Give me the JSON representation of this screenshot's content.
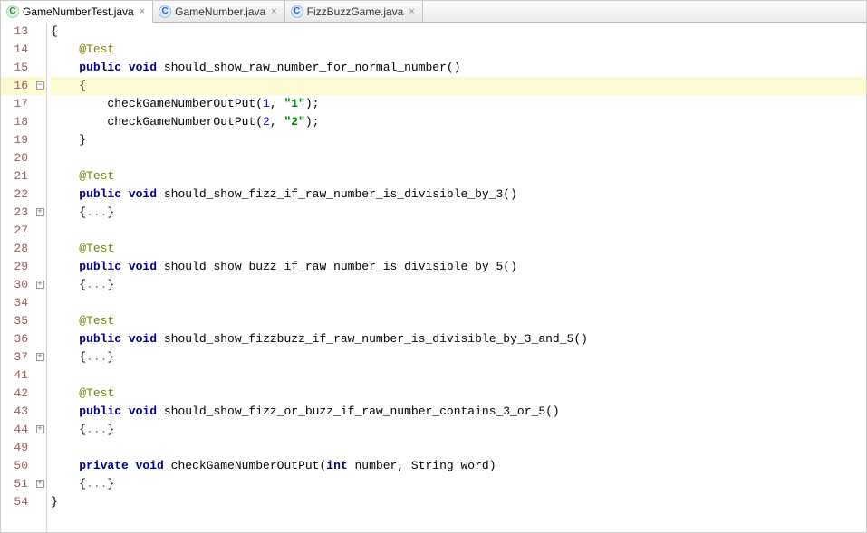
{
  "tabs": [
    {
      "label": "GameNumberTest.java",
      "icon_letter": "C",
      "icon_class": "c-green",
      "active": true
    },
    {
      "label": "GameNumber.java",
      "icon_letter": "C",
      "icon_class": "c-blue",
      "active": false
    },
    {
      "label": "FizzBuzzGame.java",
      "icon_letter": "C",
      "icon_class": "c-blue",
      "active": false
    }
  ],
  "close_glyph": "×",
  "fold_plus": "+",
  "fold_minus": "−",
  "lines": [
    {
      "n": "13",
      "fold": "",
      "hl": false,
      "segs": [
        {
          "t": "{",
          "c": ""
        }
      ]
    },
    {
      "n": "14",
      "fold": "",
      "hl": false,
      "segs": [
        {
          "t": "    ",
          "c": ""
        },
        {
          "t": "@Test",
          "c": "ann"
        }
      ]
    },
    {
      "n": "15",
      "fold": "",
      "hl": false,
      "segs": [
        {
          "t": "    ",
          "c": ""
        },
        {
          "t": "public void",
          "c": "kw"
        },
        {
          "t": " should_show_raw_number_for_normal_number()",
          "c": ""
        }
      ]
    },
    {
      "n": "16",
      "fold": "minus",
      "hl": true,
      "segs": [
        {
          "t": "    {",
          "c": ""
        }
      ]
    },
    {
      "n": "17",
      "fold": "",
      "hl": false,
      "segs": [
        {
          "t": "        checkGameNumberOutPut(",
          "c": ""
        },
        {
          "t": "1",
          "c": "num"
        },
        {
          "t": ", ",
          "c": ""
        },
        {
          "t": "\"1\"",
          "c": "str"
        },
        {
          "t": ");",
          "c": ""
        }
      ]
    },
    {
      "n": "18",
      "fold": "",
      "hl": false,
      "segs": [
        {
          "t": "        checkGameNumberOutPut(",
          "c": ""
        },
        {
          "t": "2",
          "c": "num"
        },
        {
          "t": ", ",
          "c": ""
        },
        {
          "t": "\"2\"",
          "c": "str"
        },
        {
          "t": ");",
          "c": ""
        }
      ]
    },
    {
      "n": "19",
      "fold": "",
      "hl": false,
      "segs": [
        {
          "t": "    }",
          "c": ""
        }
      ]
    },
    {
      "n": "20",
      "fold": "",
      "hl": false,
      "segs": [
        {
          "t": "",
          "c": ""
        }
      ]
    },
    {
      "n": "21",
      "fold": "",
      "hl": false,
      "segs": [
        {
          "t": "    ",
          "c": ""
        },
        {
          "t": "@Test",
          "c": "ann"
        }
      ]
    },
    {
      "n": "22",
      "fold": "",
      "hl": false,
      "segs": [
        {
          "t": "    ",
          "c": ""
        },
        {
          "t": "public void",
          "c": "kw"
        },
        {
          "t": " should_show_fizz_if_raw_number_is_divisible_by_3()",
          "c": ""
        }
      ]
    },
    {
      "n": "23",
      "fold": "plus",
      "hl": false,
      "segs": [
        {
          "t": "    {",
          "c": ""
        },
        {
          "t": "...",
          "c": "fold-dots"
        },
        {
          "t": "}",
          "c": ""
        }
      ]
    },
    {
      "n": "27",
      "fold": "",
      "hl": false,
      "segs": [
        {
          "t": "",
          "c": ""
        }
      ]
    },
    {
      "n": "28",
      "fold": "",
      "hl": false,
      "segs": [
        {
          "t": "    ",
          "c": ""
        },
        {
          "t": "@Test",
          "c": "ann"
        }
      ]
    },
    {
      "n": "29",
      "fold": "",
      "hl": false,
      "segs": [
        {
          "t": "    ",
          "c": ""
        },
        {
          "t": "public void",
          "c": "kw"
        },
        {
          "t": " should_show_buzz_if_raw_number_is_divisible_by_5()",
          "c": ""
        }
      ]
    },
    {
      "n": "30",
      "fold": "plus",
      "hl": false,
      "segs": [
        {
          "t": "    {",
          "c": ""
        },
        {
          "t": "...",
          "c": "fold-dots"
        },
        {
          "t": "}",
          "c": ""
        }
      ]
    },
    {
      "n": "34",
      "fold": "",
      "hl": false,
      "segs": [
        {
          "t": "",
          "c": ""
        }
      ]
    },
    {
      "n": "35",
      "fold": "",
      "hl": false,
      "segs": [
        {
          "t": "    ",
          "c": ""
        },
        {
          "t": "@Test",
          "c": "ann"
        }
      ]
    },
    {
      "n": "36",
      "fold": "",
      "hl": false,
      "segs": [
        {
          "t": "    ",
          "c": ""
        },
        {
          "t": "public void",
          "c": "kw"
        },
        {
          "t": " should_show_fizzbuzz_if_raw_number_is_divisible_by_3_and_5()",
          "c": ""
        }
      ]
    },
    {
      "n": "37",
      "fold": "plus",
      "hl": false,
      "segs": [
        {
          "t": "    {",
          "c": ""
        },
        {
          "t": "...",
          "c": "fold-dots"
        },
        {
          "t": "}",
          "c": ""
        }
      ]
    },
    {
      "n": "41",
      "fold": "",
      "hl": false,
      "segs": [
        {
          "t": "",
          "c": ""
        }
      ]
    },
    {
      "n": "42",
      "fold": "",
      "hl": false,
      "segs": [
        {
          "t": "    ",
          "c": ""
        },
        {
          "t": "@Test",
          "c": "ann"
        }
      ]
    },
    {
      "n": "43",
      "fold": "",
      "hl": false,
      "segs": [
        {
          "t": "    ",
          "c": ""
        },
        {
          "t": "public void",
          "c": "kw"
        },
        {
          "t": " should_show_fizz_or_buzz_if_raw_number_contains_3_or_5()",
          "c": ""
        }
      ]
    },
    {
      "n": "44",
      "fold": "plus",
      "hl": false,
      "segs": [
        {
          "t": "    {",
          "c": ""
        },
        {
          "t": "...",
          "c": "fold-dots"
        },
        {
          "t": "}",
          "c": ""
        }
      ]
    },
    {
      "n": "49",
      "fold": "",
      "hl": false,
      "segs": [
        {
          "t": "",
          "c": ""
        }
      ]
    },
    {
      "n": "50",
      "fold": "",
      "hl": false,
      "segs": [
        {
          "t": "    ",
          "c": ""
        },
        {
          "t": "private void",
          "c": "kw"
        },
        {
          "t": " checkGameNumberOutPut(",
          "c": ""
        },
        {
          "t": "int",
          "c": "kw"
        },
        {
          "t": " number, String word)",
          "c": ""
        }
      ]
    },
    {
      "n": "51",
      "fold": "plus",
      "hl": false,
      "segs": [
        {
          "t": "    {",
          "c": ""
        },
        {
          "t": "...",
          "c": "fold-dots"
        },
        {
          "t": "}",
          "c": ""
        }
      ]
    },
    {
      "n": "54",
      "fold": "",
      "hl": false,
      "segs": [
        {
          "t": "}",
          "c": ""
        }
      ]
    }
  ]
}
